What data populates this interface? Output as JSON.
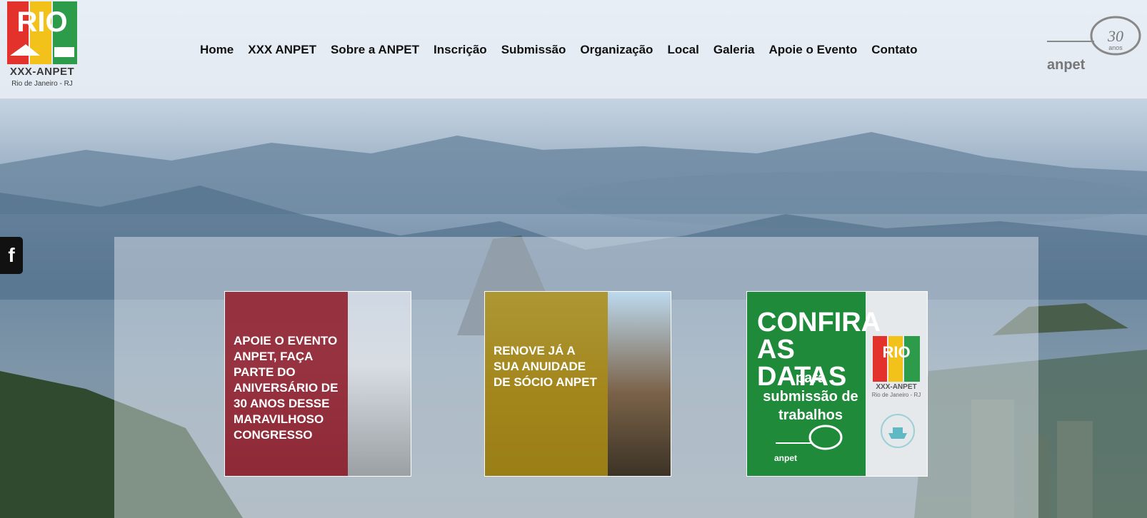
{
  "logo": {
    "title": "XXX-ANPET",
    "subtitle": "Rio de Janeiro - RJ",
    "mark": "RIO"
  },
  "nav": [
    "Home",
    "XXX ANPET",
    "Sobre a ANPET",
    "Inscrição",
    "Submissão",
    "Organização",
    "Local",
    "Galeria",
    "Apoie o Evento",
    "Contato"
  ],
  "partner_logo": {
    "text": "anpet",
    "badge_number": "30",
    "badge_label": "anos"
  },
  "social": {
    "facebook_glyph": "f"
  },
  "cards": [
    {
      "text": "Apoie o evento ANPET, faça parte do aniversário de 30 anos desse maravilhoso congresso"
    },
    {
      "text": "Renove já a sua anuidade de sócio ANPET"
    },
    {
      "headline": "CONFIRA AS DATAS",
      "subline": "para submissão de trabalhos",
      "brand": "anpet",
      "mini_title": "XXX-ANPET",
      "mini_sub": "Rio de Janeiro - RJ"
    }
  ],
  "colors": {
    "card1_overlay": "#8c1423",
    "card2_overlay": "#aa8c14",
    "card3_green": "#1f8a3a",
    "logo_red": "#e2322b",
    "logo_yellow": "#f2c21b",
    "logo_green": "#2d9c4a"
  }
}
